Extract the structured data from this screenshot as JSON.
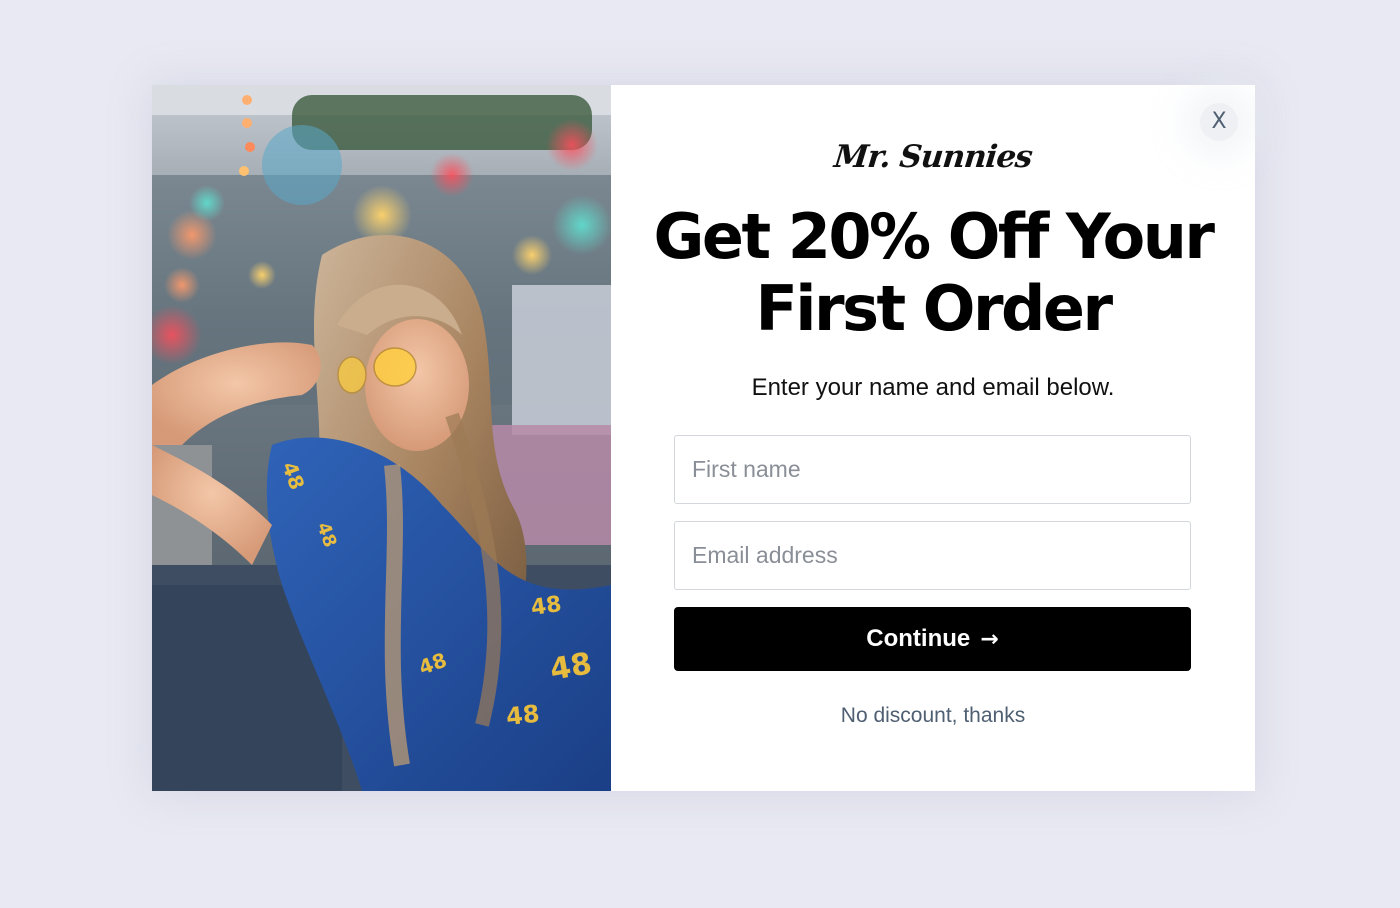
{
  "popup": {
    "close_label": "X",
    "brand": "Mr. Sunnies",
    "headline_line1": "Get 20% Off Your",
    "headline_line2": "First Order",
    "subtext": "Enter your name and email below.",
    "first_name_placeholder": "First name",
    "email_placeholder": "Email address",
    "continue_label": "Continue",
    "continue_icon": "→",
    "decline_label": "No discount, thanks"
  },
  "photo": {
    "shirt_number": "48"
  },
  "colors": {
    "background": "#e8e9f2",
    "button": "#000000",
    "decline_text": "#4f5f72"
  }
}
